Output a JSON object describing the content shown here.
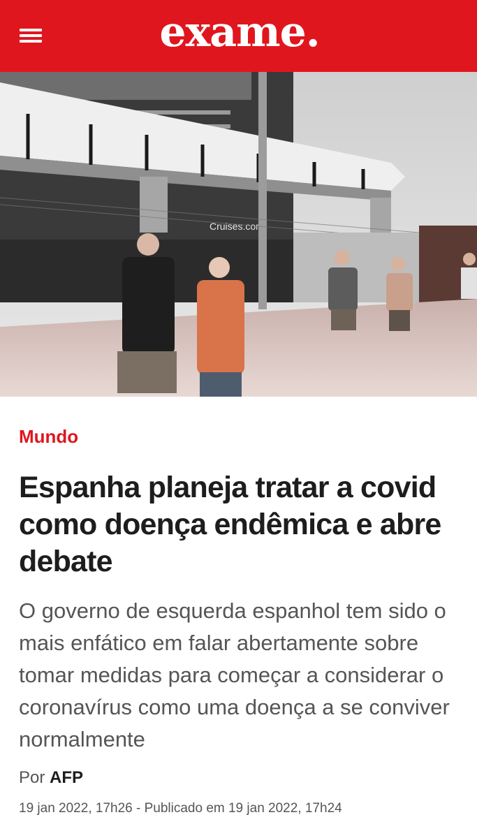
{
  "header": {
    "logo": "exame.",
    "menu_icon": "hamburger-menu-icon",
    "background_color": "#e0161e"
  },
  "article": {
    "category": "Mundo",
    "category_color": "#e0161e",
    "title": "Espanha planeja tratar a covid como doença endêmica e abre debate",
    "lead": "O governo de esquerda espanhol tem sido o mais enfático em falar abertamente sobre tomar medidas para começar a considerar o coronavírus como uma doença a se conviver normalmente",
    "byline_prefix": "Por",
    "author": "AFP",
    "dates": "19 jan 2022, 17h26 - Publicado em 19 jan 2022, 17h24",
    "image": {
      "ship_label": "Cruises.com"
    }
  }
}
